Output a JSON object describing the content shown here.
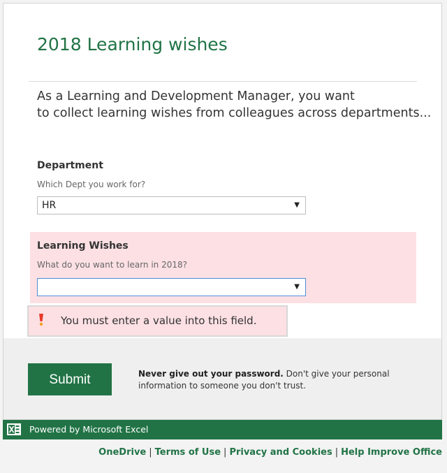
{
  "form": {
    "title": "2018 Learning wishes",
    "description_line1": "As a Learning and Development Manager, you want",
    "description_line2": "to collect learning wishes from colleagues across departments..."
  },
  "questions": [
    {
      "label": "Department",
      "hint": "Which Dept you work for?",
      "selected_value": "HR"
    },
    {
      "label": "Learning Wishes",
      "hint": "What do you want to learn in 2018?",
      "selected_value": ""
    }
  ],
  "error": {
    "message": "You must enter a value into this field.",
    "icon": "exclamation-icon"
  },
  "submit": {
    "label": "Submit"
  },
  "notice": {
    "bold": "Never give out your password.",
    "text": " Don't give your personal information to someone you don't trust."
  },
  "powered_by": {
    "text": "Powered by Microsoft Excel",
    "icon": "excel-icon"
  },
  "footer_links": [
    "OneDrive",
    "Terms of Use",
    "Privacy and Cookies",
    "Help Improve Office"
  ],
  "colors": {
    "accent": "#217346",
    "error_bg": "#fce0e4",
    "focus_border": "#4a8fd6"
  }
}
